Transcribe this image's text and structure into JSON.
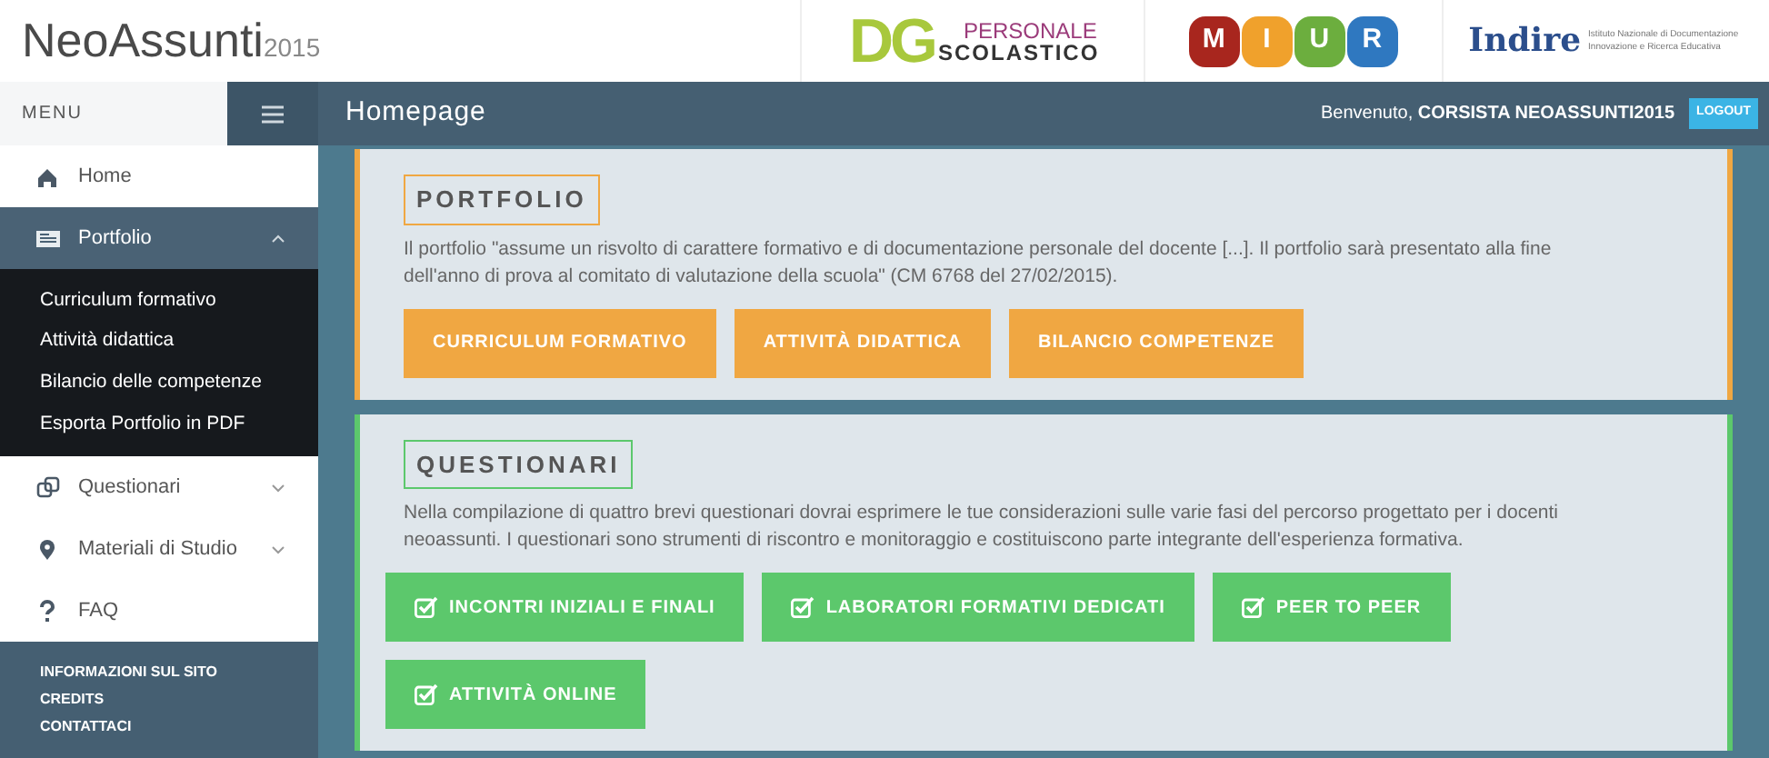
{
  "header": {
    "brand": "NeoAssunti",
    "year": "2015",
    "dg_logo": {
      "letters": "DG",
      "top": "PERSONALE",
      "bottom": "SCOLASTICO"
    },
    "miur_logo": [
      {
        "letter": "M",
        "color": "#a8261e"
      },
      {
        "letter": "I",
        "color": "#f0a12c"
      },
      {
        "letter": "U",
        "color": "#6cae3e"
      },
      {
        "letter": "R",
        "color": "#2f78c0"
      }
    ],
    "indire_logo": {
      "name": "Indire",
      "tagline_1": "Istituto Nazionale di Documentazione",
      "tagline_2": "Innovazione e Ricerca Educativa"
    }
  },
  "topbar": {
    "menu_label": "MENU",
    "page_title": "Homepage",
    "welcome": "Benvenuto, **CORSISTA NEOASSUNTI2015**",
    "logout": "LOGOUT"
  },
  "sidebar": {
    "items": [
      {
        "label": "Home",
        "selected": false
      },
      {
        "label": "Portfolio",
        "selected": true,
        "expanded": true,
        "children": [
          {
            "label": "Curriculum formativo"
          },
          {
            "label": "Attività didattica"
          },
          {
            "label": "Bilancio delle competenze"
          },
          {
            "label": "Esporta Portfolio in PDF"
          }
        ]
      },
      {
        "label": "Questionari",
        "selected": false,
        "expanded": false
      },
      {
        "label": "Materiali di Studio",
        "selected": false,
        "expanded": false
      },
      {
        "label": "FAQ",
        "selected": false
      }
    ],
    "footer_links": [
      "INFORMAZIONI SUL SITO",
      "CREDITS",
      "CONTATTACI"
    ]
  },
  "cards": [
    {
      "title": "PORTFOLIO",
      "color": "#f0a742",
      "kind": "plain",
      "text": "Il portfolio \"assume un risvolto di carattere formativo e di documentazione personale del docente [...]. Il portfolio sarà presentato alla fine dell'anno di prova al comitato di valutazione della scuola\" (CM 6768 del 27/02/2015).",
      "buttons": [
        "CURRICULUM FORMATIVO",
        "ATTIVITÀ DIDATTICA",
        "BILANCIO COMPETENZE"
      ]
    },
    {
      "title": "QUESTIONARI",
      "color": "#5cc86c",
      "kind": "checklist",
      "text": "Nella compilazione di quattro brevi questionari dovrai esprimere le tue considerazioni sulle varie fasi del percorso progettato per i docenti neoassunti. I questionari sono strumenti di riscontro e monitoraggio e costituiscono parte integrante dell'esperienza formativa.",
      "buttons": [
        "INCONTRI INIZIALI E FINALI",
        "LABORATORI FORMATIVI DEDICATI",
        "PEER TO PEER",
        "ATTIVITÀ ONLINE"
      ]
    }
  ]
}
